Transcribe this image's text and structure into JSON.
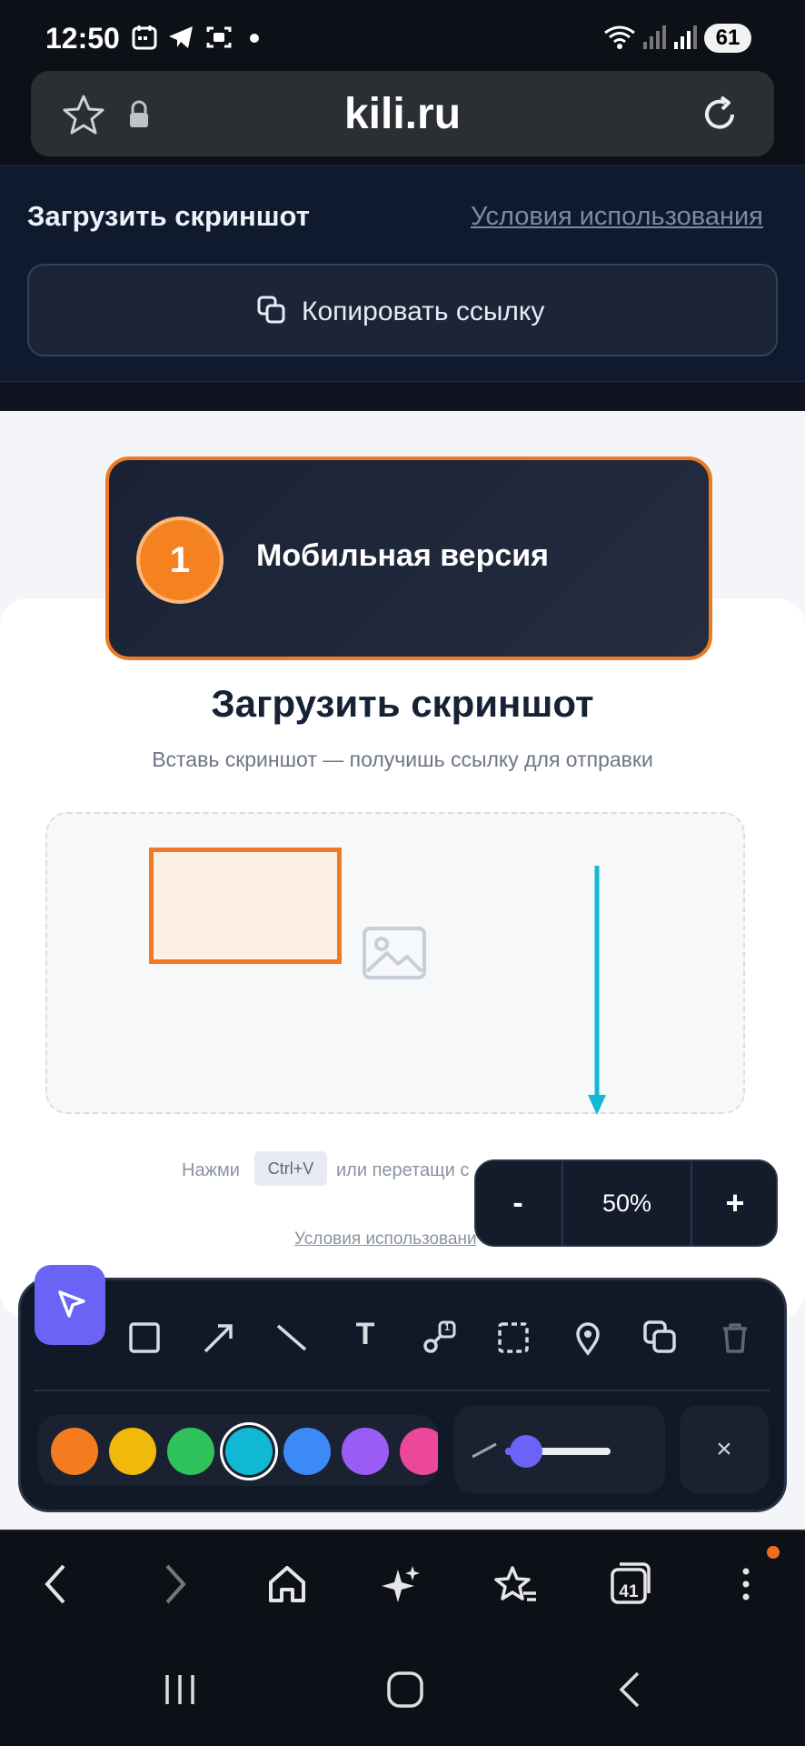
{
  "status_bar": {
    "time": "12:50",
    "battery": "61"
  },
  "browser": {
    "url": "kili.ru"
  },
  "header": {
    "title": "Загрузить скриншот",
    "terms_link": "Условия использования",
    "copy_button": "Копировать ссылку"
  },
  "callout": {
    "number": "1",
    "text": "Мобильная версия"
  },
  "card": {
    "title": "Загрузить скриншот",
    "subtitle": "Вставь скриншот — получишь ссылку для отправки",
    "hint_press": "Нажми",
    "hint_key": "Ctrl+V",
    "hint_rest": "или перетащи с",
    "terms": "Условия использовани"
  },
  "zoom": {
    "minus": "-",
    "value": "50%",
    "plus": "+"
  },
  "toolbar": {
    "tools": [
      "select-icon",
      "rectangle-icon",
      "arrow-icon",
      "line-icon",
      "text-icon",
      "numbered-marker-icon",
      "crop-select-icon",
      "pin-icon",
      "copy-icon",
      "trash-icon"
    ],
    "text_tool_label": "T",
    "marker_number": "1",
    "colors": [
      "#f47b20",
      "#f0b90b",
      "#2fc25b",
      "#11b8d4",
      "#3d8af7",
      "#9b5cf6",
      "#ec4899"
    ],
    "selected_color": "#11b8d4",
    "width_level": 0.15,
    "close_label": "×"
  },
  "browser_nav": {
    "tabs_count": "41"
  }
}
